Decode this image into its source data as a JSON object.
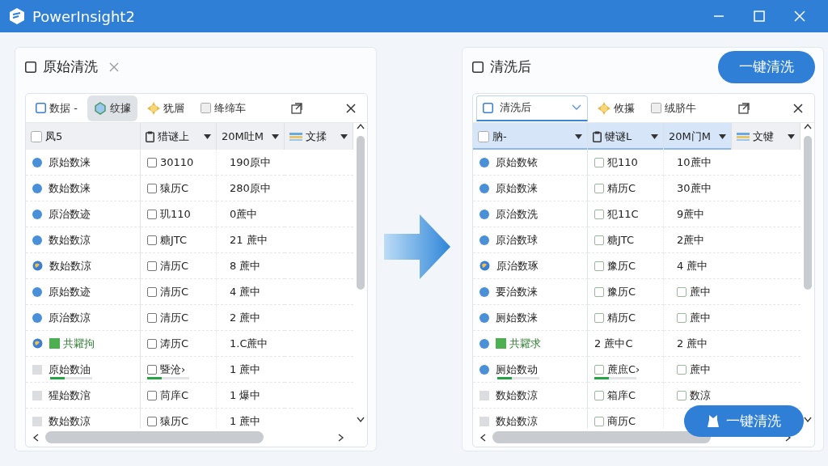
{
  "window": {
    "title": "PowerInsight2"
  },
  "panels": [
    {
      "title": "原始清洗",
      "closable": true,
      "toolbar": [
        {
          "kind": "check",
          "label": "数据 -",
          "selected": false
        },
        {
          "kind": "gem",
          "label": "纹據",
          "selected": true
        },
        {
          "kind": "sun",
          "label": "犹層",
          "selected": false
        },
        {
          "kind": "box",
          "label": "绛缔车",
          "selected": false
        },
        {
          "kind": "export",
          "selected": false
        },
        {
          "kind": "close",
          "selected": false
        }
      ],
      "columns": [
        {
          "kind": "check",
          "label": "凤5",
          "filter": false,
          "selected": false
        },
        {
          "kind": "clip",
          "label": "猎谜上",
          "filter": true,
          "selected": false
        },
        {
          "kind": "plain",
          "label": "20M吐M",
          "filter": true,
          "selected": false
        },
        {
          "kind": "lines",
          "label": "文揉",
          "filter": true,
          "selected": false
        }
      ],
      "rows": [
        {
          "kind": "dot",
          "name": {
            "text": "原始数涞"
          },
          "col2": {
            "kind": "check",
            "checked": false,
            "text": "30110"
          },
          "col3": {
            "kind": "plain",
            "text": "190原中"
          }
        },
        {
          "kind": "dot",
          "name": {
            "text": "数始数涞"
          },
          "col2": {
            "kind": "check",
            "checked": false,
            "text": "猿历C"
          },
          "col3": {
            "kind": "plain",
            "text": "280原中"
          }
        },
        {
          "kind": "dot",
          "name": {
            "text": "原治数迹"
          },
          "col2": {
            "kind": "check",
            "checked": false,
            "text": "玑110"
          },
          "col3": {
            "kind": "plain",
            "text": "0蔗中"
          }
        },
        {
          "kind": "dot",
          "name": {
            "text": "数始数涼"
          },
          "col2": {
            "kind": "check",
            "checked": false,
            "text": "糖JTC"
          },
          "col3": {
            "kind": "plain",
            "text": "21 蔗中"
          }
        },
        {
          "kind": "globe",
          "name": {
            "text": "数始数涼"
          },
          "col2": {
            "kind": "check",
            "checked": false,
            "text": "清历C"
          },
          "col3": {
            "kind": "plain",
            "text": "8 蔗中"
          }
        },
        {
          "kind": "dot",
          "name": {
            "text": "原始数迹"
          },
          "col2": {
            "kind": "check",
            "checked": false,
            "text": "清历C"
          },
          "col3": {
            "kind": "plain",
            "text": "4 蔗中"
          }
        },
        {
          "kind": "dot",
          "name": {
            "text": "原治数涼"
          },
          "col2": {
            "kind": "check",
            "checked": false,
            "text": "清历C"
          },
          "col3": {
            "kind": "plain",
            "text": "2 蔗中"
          }
        },
        {
          "kind": "globe",
          "tag": true,
          "name": {
            "text": "共糶拘"
          },
          "col2": {
            "kind": "check",
            "checked": false,
            "text": "涛历C"
          },
          "col3": {
            "kind": "plain",
            "text": "1.C蔗中"
          }
        },
        {
          "kind": "square",
          "name": {
            "text": "原始数油",
            "level": 0.35
          },
          "col2": {
            "kind": "check",
            "checked": false,
            "text": "暨沧›",
            "level": 0.35
          },
          "col3": {
            "kind": "plain",
            "text": "1 蔗中"
          }
        },
        {
          "kind": "square",
          "name": {
            "text": "猩始数涫"
          },
          "col2": {
            "kind": "check",
            "checked": false,
            "text": "苘庠C"
          },
          "col3": {
            "kind": "plain",
            "text": "1 爆中"
          }
        },
        {
          "kind": "square",
          "name": {
            "text": "数始数涼"
          },
          "col2": {
            "kind": "check",
            "checked": false,
            "text": "猿历C"
          },
          "col3": {
            "kind": "plain",
            "text": "1 蔗中"
          }
        }
      ]
    },
    {
      "title": "清洗后",
      "closable": false,
      "action": "一键清洗",
      "toolbar": [
        {
          "kind": "dropdown",
          "label": "清洗后",
          "selected": true
        },
        {
          "kind": "sun",
          "label": "攸攥",
          "selected": false
        },
        {
          "kind": "box",
          "label": "绒脐牛",
          "selected": false
        },
        {
          "kind": "export",
          "selected": false
        },
        {
          "kind": "close",
          "selected": false
        }
      ],
      "columns": [
        {
          "kind": "check",
          "label": "肭-",
          "filter": true,
          "selected": true
        },
        {
          "kind": "clip",
          "label": "犍谜L",
          "filter": true,
          "selected": true
        },
        {
          "kind": "plain",
          "label": "20M门M",
          "filter": true,
          "selected": true
        },
        {
          "kind": "lines",
          "label": "文犍",
          "filter": true,
          "selected": false
        }
      ],
      "rows": [
        {
          "kind": "dot",
          "name": {
            "text": "原始数铱"
          },
          "col2": {
            "kind": "check",
            "checked": false,
            "text": "犯110"
          },
          "col3": {
            "kind": "plain",
            "text": "10蔗中"
          }
        },
        {
          "kind": "dot",
          "name": {
            "text": "原始数涞"
          },
          "col2": {
            "kind": "check",
            "checked": false,
            "text": "精历C"
          },
          "col3": {
            "kind": "plain",
            "text": "30蔗中"
          }
        },
        {
          "kind": "dot",
          "name": {
            "text": "原治数洗"
          },
          "col2": {
            "kind": "check",
            "checked": false,
            "text": "犯11C"
          },
          "col3": {
            "kind": "plain",
            "text": "9蔗中"
          }
        },
        {
          "kind": "dot",
          "name": {
            "text": "原治数球"
          },
          "col2": {
            "kind": "check",
            "checked": false,
            "text": "糖JTC"
          },
          "col3": {
            "kind": "plain",
            "text": "2蔗中"
          }
        },
        {
          "kind": "globe",
          "name": {
            "text": "原治数琢"
          },
          "col2": {
            "kind": "check",
            "checked": false,
            "text": "豫历C"
          },
          "col3": {
            "kind": "plain",
            "text": "4 蔗中"
          }
        },
        {
          "kind": "dot",
          "name": {
            "text": "要治数涞"
          },
          "col2": {
            "kind": "check",
            "checked": false,
            "text": "豫历C"
          },
          "col3": {
            "kind": "check",
            "checked": false,
            "text": "蔗中"
          }
        },
        {
          "kind": "dot",
          "name": {
            "text": "厕始数涞"
          },
          "col2": {
            "kind": "check",
            "checked": false,
            "text": "精历C"
          },
          "col3": {
            "kind": "check",
            "checked": false,
            "text": "蔗中"
          }
        },
        {
          "kind": "dot",
          "tag": true,
          "name": {
            "text": "共糶求"
          },
          "col2": {
            "kind": "plain",
            "text": "2 蔗中C"
          },
          "col3": {
            "kind": "plain",
            "text": "2 蔗中"
          }
        },
        {
          "kind": "dot",
          "name": {
            "text": "厕始数动",
            "level": 0.35
          },
          "col2": {
            "kind": "check",
            "checked": false,
            "text": "蔗庶C›",
            "level": 0.35
          },
          "col3": {
            "kind": "check",
            "checked": false,
            "text": "蔗中"
          }
        },
        {
          "kind": "square",
          "name": {
            "text": "数始数涼"
          },
          "col2": {
            "kind": "check",
            "checked": false,
            "text": "箱庠C"
          },
          "col3": {
            "kind": "check",
            "checked": false,
            "text": "数涼"
          }
        },
        {
          "kind": "square",
          "name": {
            "text": "数始数涼"
          },
          "col2": {
            "kind": "check",
            "checked": false,
            "text": "商历C"
          }
        }
      ],
      "float_button": {
        "label": "一键清洗"
      }
    }
  ]
}
